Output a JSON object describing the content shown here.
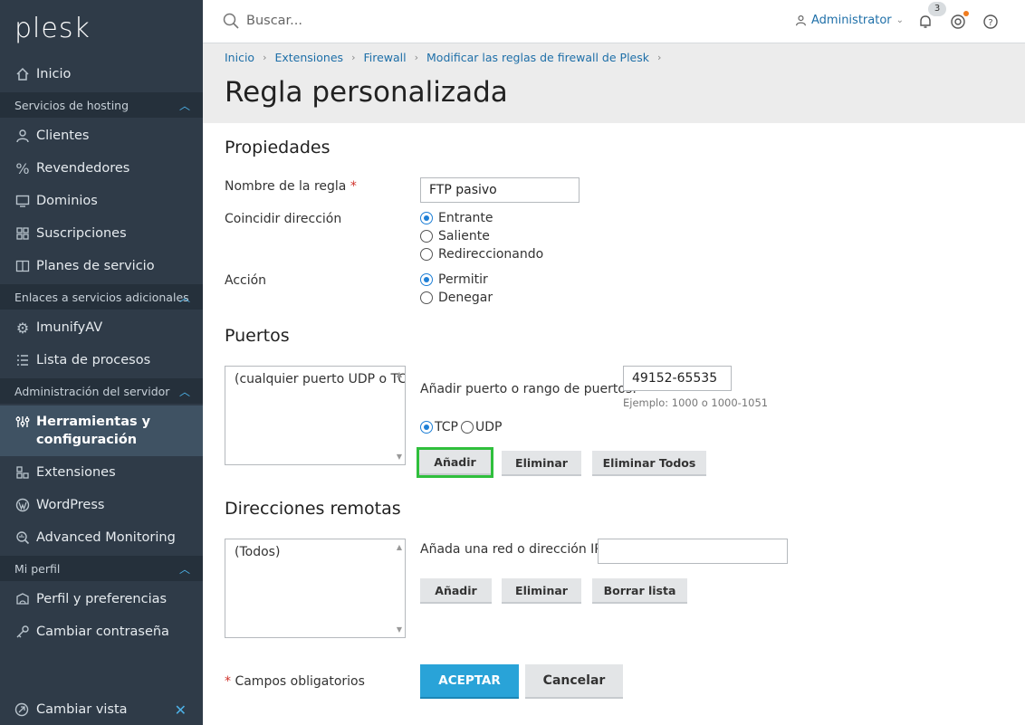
{
  "sidebar": {
    "logo": "plesk",
    "home": "Inicio",
    "sections": {
      "hosting": "Servicios de hosting",
      "links": "Enlaces a servicios adicionales",
      "server": "Administración del servidor",
      "profile": "Mi perfil"
    },
    "items": {
      "clients": "Clientes",
      "resellers": "Revendedores",
      "domains": "Dominios",
      "subscriptions": "Suscripciones",
      "plans": "Planes de servicio",
      "imunify": "ImunifyAV",
      "processes": "Lista de procesos",
      "tools_line1": "Herramientas y",
      "tools_line2": "configuración",
      "extensions": "Extensiones",
      "wordpress": "WordPress",
      "monitoring": "Advanced Monitoring",
      "profile_prefs": "Perfil y preferencias",
      "change_password": "Cambiar contraseña"
    },
    "switch_view": "Cambiar vista"
  },
  "topbar": {
    "search_placeholder": "Buscar...",
    "user": "Administrator",
    "notification_count": "3"
  },
  "breadcrumb": [
    "Inicio",
    "Extensiones",
    "Firewall",
    "Modificar las reglas de firewall de Plesk"
  ],
  "page_title": "Regla personalizada",
  "form": {
    "properties_heading": "Propiedades",
    "rule_name_label": "Nombre de la regla",
    "required_mark": "*",
    "rule_name_value": "FTP pasivo",
    "direction_label": "Coincidir dirección",
    "direction_options": [
      "Entrante",
      "Saliente",
      "Redireccionando"
    ],
    "direction_selected": "Entrante",
    "action_label": "Acción",
    "action_options": [
      "Permitir",
      "Denegar"
    ],
    "action_selected": "Permitir",
    "ports_heading": "Puertos",
    "ports_list_item": "(cualquier puerto UDP o TCP)",
    "add_port_label": "Añadir puerto o rango de puertos:",
    "port_value": "49152-65535",
    "port_hint": "Ejemplo: 1000 o 1000-1051",
    "proto_tcp": "TCP",
    "proto_udp": "UDP",
    "btn_add": "Añadir",
    "btn_remove": "Eliminar",
    "btn_remove_all": "Eliminar Todos",
    "remote_heading": "Direcciones remotas",
    "remote_list_item": "(Todos)",
    "add_ip_label": "Añada una red o dirección IP:",
    "btn_add2": "Añadir",
    "btn_remove2": "Eliminar",
    "btn_clear": "Borrar lista",
    "required_note": "Campos obligatorios",
    "btn_accept": "ACEPTAR",
    "btn_cancel": "Cancelar"
  }
}
